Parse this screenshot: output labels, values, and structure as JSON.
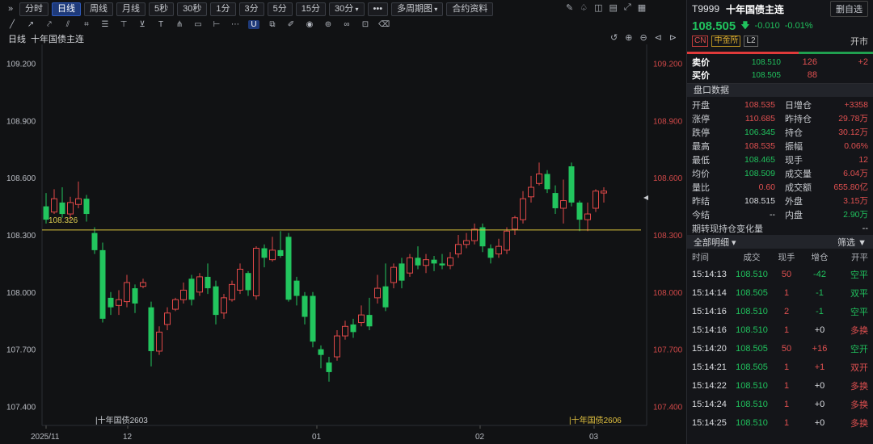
{
  "toolbar": {
    "tabs": [
      "分时",
      "日线",
      "周线",
      "月线",
      "5秒",
      "30秒",
      "1分",
      "3分",
      "5分",
      "15分",
      "30分"
    ],
    "active_tab": "日线",
    "more": "•••",
    "multi_period": "多周期图",
    "contract_info": "合约资料"
  },
  "chart": {
    "period_label": "日线",
    "title": "十年国债主连"
  },
  "chart_data": {
    "type": "candlestick",
    "ylim": [
      107.3,
      109.3
    ],
    "y_ticks": [
      "109.200",
      "108.900",
      "108.600",
      "108.300",
      "108.000",
      "107.700",
      "107.400"
    ],
    "x_ticks": [
      "2025/11",
      "12",
      "01",
      "02",
      "03"
    ],
    "reference_line": {
      "value": 108.326,
      "label": "108.326"
    },
    "contract_switch_labels": [
      "十年国债2603",
      "十年国债2606"
    ],
    "candles": [
      [
        108.45,
        108.38,
        108.52,
        108.36
      ],
      [
        108.42,
        108.49,
        108.54,
        108.41
      ],
      [
        108.47,
        108.41,
        108.55,
        108.39
      ],
      [
        108.41,
        108.47,
        108.5,
        108.38
      ],
      [
        108.46,
        108.49,
        108.58,
        108.44
      ],
      [
        108.49,
        108.41,
        108.51,
        108.37
      ],
      [
        108.31,
        108.22,
        108.34,
        108.2
      ],
      [
        108.22,
        107.86,
        108.26,
        107.84
      ],
      [
        107.97,
        107.92,
        108.0,
        107.88
      ],
      [
        107.93,
        107.96,
        108.01,
        107.88
      ],
      [
        107.95,
        108.05,
        108.09,
        107.92
      ],
      [
        108.02,
        107.94,
        108.04,
        107.89
      ],
      [
        108.03,
        108.05,
        108.07,
        108.02
      ],
      [
        107.92,
        107.69,
        107.95,
        107.61
      ],
      [
        107.69,
        107.79,
        107.82,
        107.67
      ],
      [
        107.83,
        107.89,
        107.92,
        107.8
      ],
      [
        107.91,
        107.96,
        107.97,
        107.9
      ],
      [
        107.96,
        108.01,
        108.05,
        107.94
      ],
      [
        108.07,
        107.96,
        108.09,
        107.93
      ],
      [
        108.0,
        108.08,
        108.1,
        107.98
      ],
      [
        108.08,
        108.02,
        108.15,
        107.99
      ],
      [
        108.03,
        107.88,
        108.06,
        107.83
      ],
      [
        107.89,
        107.97,
        107.99,
        107.86
      ],
      [
        107.96,
        108.04,
        108.06,
        107.95
      ],
      [
        108.01,
        108.12,
        108.15,
        107.99
      ],
      [
        108.1,
        108.01,
        108.11,
        107.98
      ],
      [
        107.98,
        108.23,
        108.24,
        107.96
      ],
      [
        108.23,
        108.18,
        108.25,
        108.13
      ],
      [
        108.17,
        108.22,
        108.29,
        108.16
      ],
      [
        108.22,
        108.19,
        108.32,
        108.18
      ],
      [
        108.29,
        107.96,
        108.31,
        107.95
      ],
      [
        108.06,
        107.98,
        108.08,
        107.93
      ],
      [
        107.98,
        107.87,
        108.0,
        107.83
      ],
      [
        107.98,
        107.74,
        108.0,
        107.71
      ],
      [
        107.7,
        107.67,
        107.72,
        107.6
      ],
      [
        107.63,
        107.58,
        107.66,
        107.53
      ],
      [
        107.66,
        107.77,
        107.8,
        107.64
      ],
      [
        107.77,
        107.82,
        107.85,
        107.75
      ],
      [
        107.83,
        107.79,
        107.86,
        107.76
      ],
      [
        107.84,
        107.88,
        107.93,
        107.82
      ],
      [
        107.88,
        107.82,
        107.97,
        107.8
      ],
      [
        107.97,
        108.02,
        108.09,
        107.94
      ],
      [
        108.03,
        107.92,
        108.15,
        107.9
      ],
      [
        108.05,
        108.13,
        108.15,
        108.02
      ],
      [
        108.15,
        108.06,
        108.18,
        108.02
      ],
      [
        108.1,
        108.18,
        108.2,
        108.08
      ],
      [
        108.18,
        108.14,
        108.24,
        108.12
      ],
      [
        108.14,
        108.17,
        108.2,
        108.1
      ],
      [
        108.17,
        108.15,
        108.19,
        108.11
      ],
      [
        108.15,
        108.14,
        108.2,
        108.12
      ],
      [
        108.14,
        108.18,
        108.21,
        108.12
      ],
      [
        108.2,
        108.25,
        108.3,
        108.18
      ],
      [
        108.25,
        108.27,
        108.31,
        108.23
      ],
      [
        108.27,
        108.33,
        108.36,
        108.25
      ],
      [
        108.34,
        108.24,
        108.36,
        108.21
      ],
      [
        108.23,
        108.18,
        108.25,
        108.15
      ],
      [
        108.2,
        108.24,
        108.28,
        108.18
      ],
      [
        108.22,
        108.32,
        108.34,
        108.2
      ],
      [
        108.33,
        108.39,
        108.4,
        108.3
      ],
      [
        108.38,
        108.49,
        108.53,
        108.36
      ],
      [
        108.5,
        108.55,
        108.61,
        108.47
      ],
      [
        108.57,
        108.62,
        108.68,
        108.56
      ],
      [
        108.62,
        108.54,
        108.64,
        108.52
      ],
      [
        108.52,
        108.44,
        108.56,
        108.41
      ],
      [
        108.44,
        108.48,
        108.59,
        108.36
      ],
      [
        108.66,
        108.47,
        108.68,
        108.45
      ],
      [
        108.47,
        108.38,
        108.48,
        108.32
      ],
      [
        108.38,
        108.41,
        108.47,
        108.32
      ],
      [
        108.44,
        108.53,
        108.54,
        108.42
      ],
      [
        108.52,
        108.53,
        108.55,
        108.47
      ]
    ]
  },
  "panel": {
    "code": "T9999",
    "name": "十年国债主连",
    "watch_button": "删自选",
    "price": "108.505",
    "change": "-0.010",
    "change_pct": "-0.01%",
    "tags": [
      "CN",
      "中金所",
      "L2"
    ],
    "status": "开市",
    "orderbook": [
      {
        "label": "卖价",
        "price": "108.510",
        "vol": "126",
        "delta": "+2"
      },
      {
        "label": "买价",
        "price": "108.505",
        "vol": "88",
        "delta": ""
      }
    ],
    "section_title": "盘口数据",
    "stats": [
      {
        "k": "开盘",
        "v": "108.535",
        "c": "red"
      },
      {
        "k": "日增仓",
        "v": "+3358",
        "c": "red"
      },
      {
        "k": "涨停",
        "v": "110.685",
        "c": "red"
      },
      {
        "k": "昨持仓",
        "v": "29.78万",
        "c": "red"
      },
      {
        "k": "跌停",
        "v": "106.345",
        "c": "green"
      },
      {
        "k": "持仓",
        "v": "30.12万",
        "c": "red"
      },
      {
        "k": "最高",
        "v": "108.535",
        "c": "red"
      },
      {
        "k": "振幅",
        "v": "0.06%",
        "c": "red"
      },
      {
        "k": "最低",
        "v": "108.465",
        "c": "green"
      },
      {
        "k": "现手",
        "v": "12",
        "c": "red"
      },
      {
        "k": "均价",
        "v": "108.509",
        "c": "green"
      },
      {
        "k": "成交量",
        "v": "6.04万",
        "c": "red"
      },
      {
        "k": "量比",
        "v": "0.60",
        "c": "red"
      },
      {
        "k": "成交额",
        "v": "655.80亿",
        "c": "red"
      },
      {
        "k": "昨结",
        "v": "108.515",
        "c": "white"
      },
      {
        "k": "外盘",
        "v": "3.15万",
        "c": "red"
      },
      {
        "k": "今结",
        "v": "--",
        "c": "white"
      },
      {
        "k": "内盘",
        "v": "2.90万",
        "c": "green"
      }
    ],
    "basis_label": "期转现持仓变化量",
    "basis_value": "--",
    "details_title": "全部明细",
    "filter_label": "筛选",
    "table_headers": [
      "时间",
      "成交",
      "现手",
      "增仓",
      "开平"
    ],
    "trades": [
      {
        "t": "15:14:13",
        "p": "108.510",
        "v": "50",
        "n": "-42",
        "nc": "green",
        "k": "空平",
        "kc": "green"
      },
      {
        "t": "15:14:14",
        "p": "108.505",
        "v": "1",
        "n": "-1",
        "nc": "green",
        "k": "双平",
        "kc": "green"
      },
      {
        "t": "15:14:16",
        "p": "108.510",
        "v": "2",
        "n": "-1",
        "nc": "green",
        "k": "空平",
        "kc": "green"
      },
      {
        "t": "15:14:16",
        "p": "108.510",
        "v": "1",
        "n": "+0",
        "nc": "white",
        "k": "多换",
        "kc": "red"
      },
      {
        "t": "15:14:20",
        "p": "108.505",
        "v": "50",
        "n": "+16",
        "nc": "red",
        "k": "空开",
        "kc": "green"
      },
      {
        "t": "15:14:21",
        "p": "108.505",
        "v": "1",
        "n": "+1",
        "nc": "red",
        "k": "双开",
        "kc": "red"
      },
      {
        "t": "15:14:22",
        "p": "108.510",
        "v": "1",
        "n": "+0",
        "nc": "white",
        "k": "多换",
        "kc": "red"
      },
      {
        "t": "15:14:24",
        "p": "108.510",
        "v": "1",
        "n": "+0",
        "nc": "white",
        "k": "多换",
        "kc": "red"
      },
      {
        "t": "15:14:25",
        "p": "108.510",
        "v": "1",
        "n": "+0",
        "nc": "white",
        "k": "多换",
        "kc": "red"
      }
    ]
  }
}
